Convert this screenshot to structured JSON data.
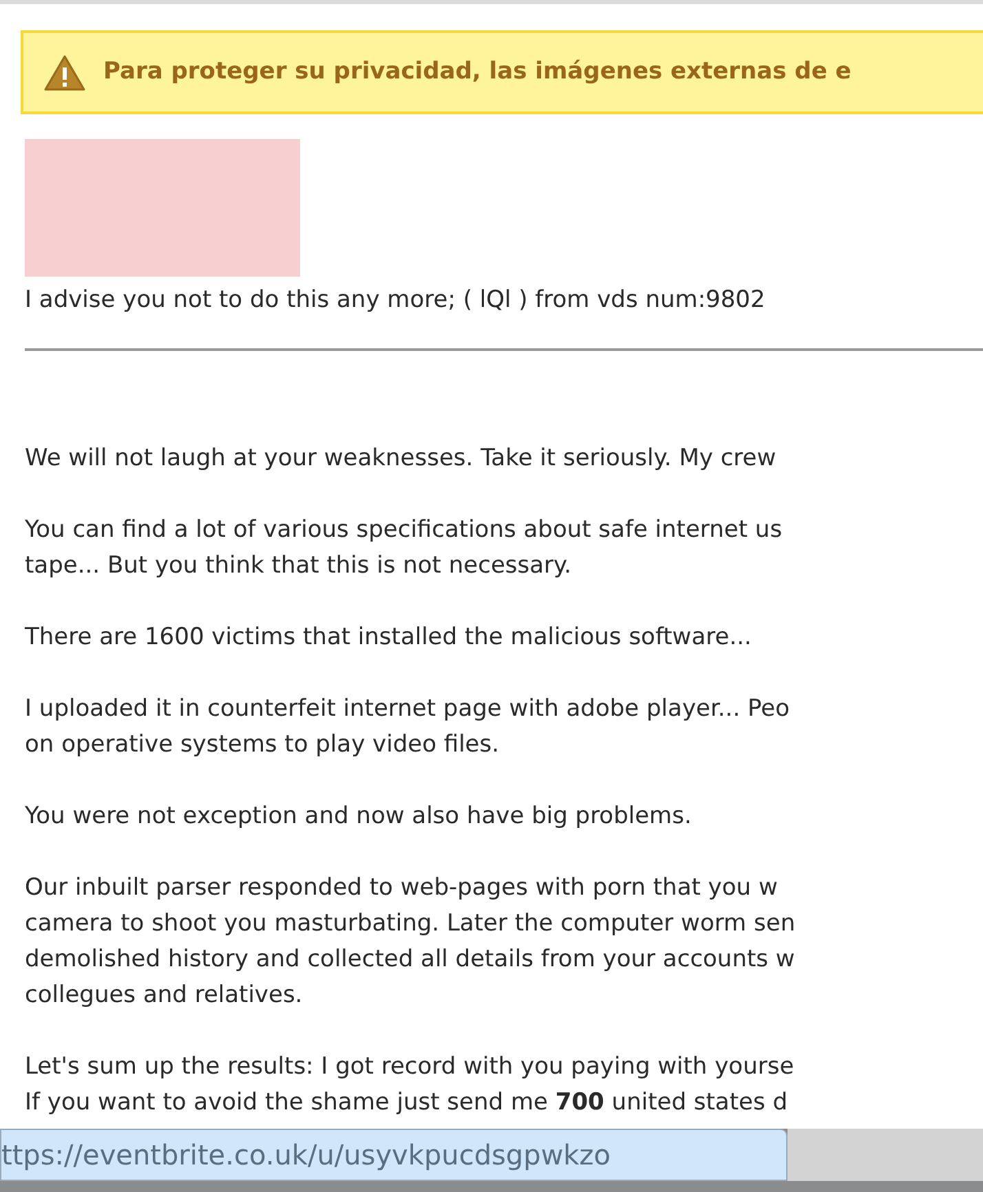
{
  "banner": {
    "text": "Para proteger su privacidad, las imágenes externas de e"
  },
  "intro": "I advise you not to do this any more; ( lQl ) from vds num:9802",
  "paragraphs": [
    {
      "lines": [
        "We will not laugh at your weaknesses. Take it seriously. My crew"
      ]
    },
    {
      "lines": [
        "You can find a lot of various specifications about safe internet us",
        "tape... But you think that this is not necessary."
      ]
    },
    {
      "lines": [
        "There are 1600 victims that installed the malicious software..."
      ]
    },
    {
      "lines": [
        "I uploaded it in counterfeit internet page with adobe player... Peo",
        "on operative systems to play video files."
      ]
    },
    {
      "lines": [
        "You were not exception and now also have big problems."
      ]
    },
    {
      "lines": [
        "Our inbuilt parser responded to web-pages with porn that you w",
        "camera to shoot you masturbating. Later the computer worm sen",
        "demolished history and collected all details from your accounts w",
        "collegues and relatives."
      ]
    },
    {
      "lines": [
        "Let's sum up the results: I got record with you paying with yourse",
        "If you want to avoid the shame just send me **700** united states d"
      ]
    }
  ],
  "link_tooltip": {
    "text": "ttps://eventbrite.co.uk/u/usyvkpucdsgpwkzo"
  }
}
